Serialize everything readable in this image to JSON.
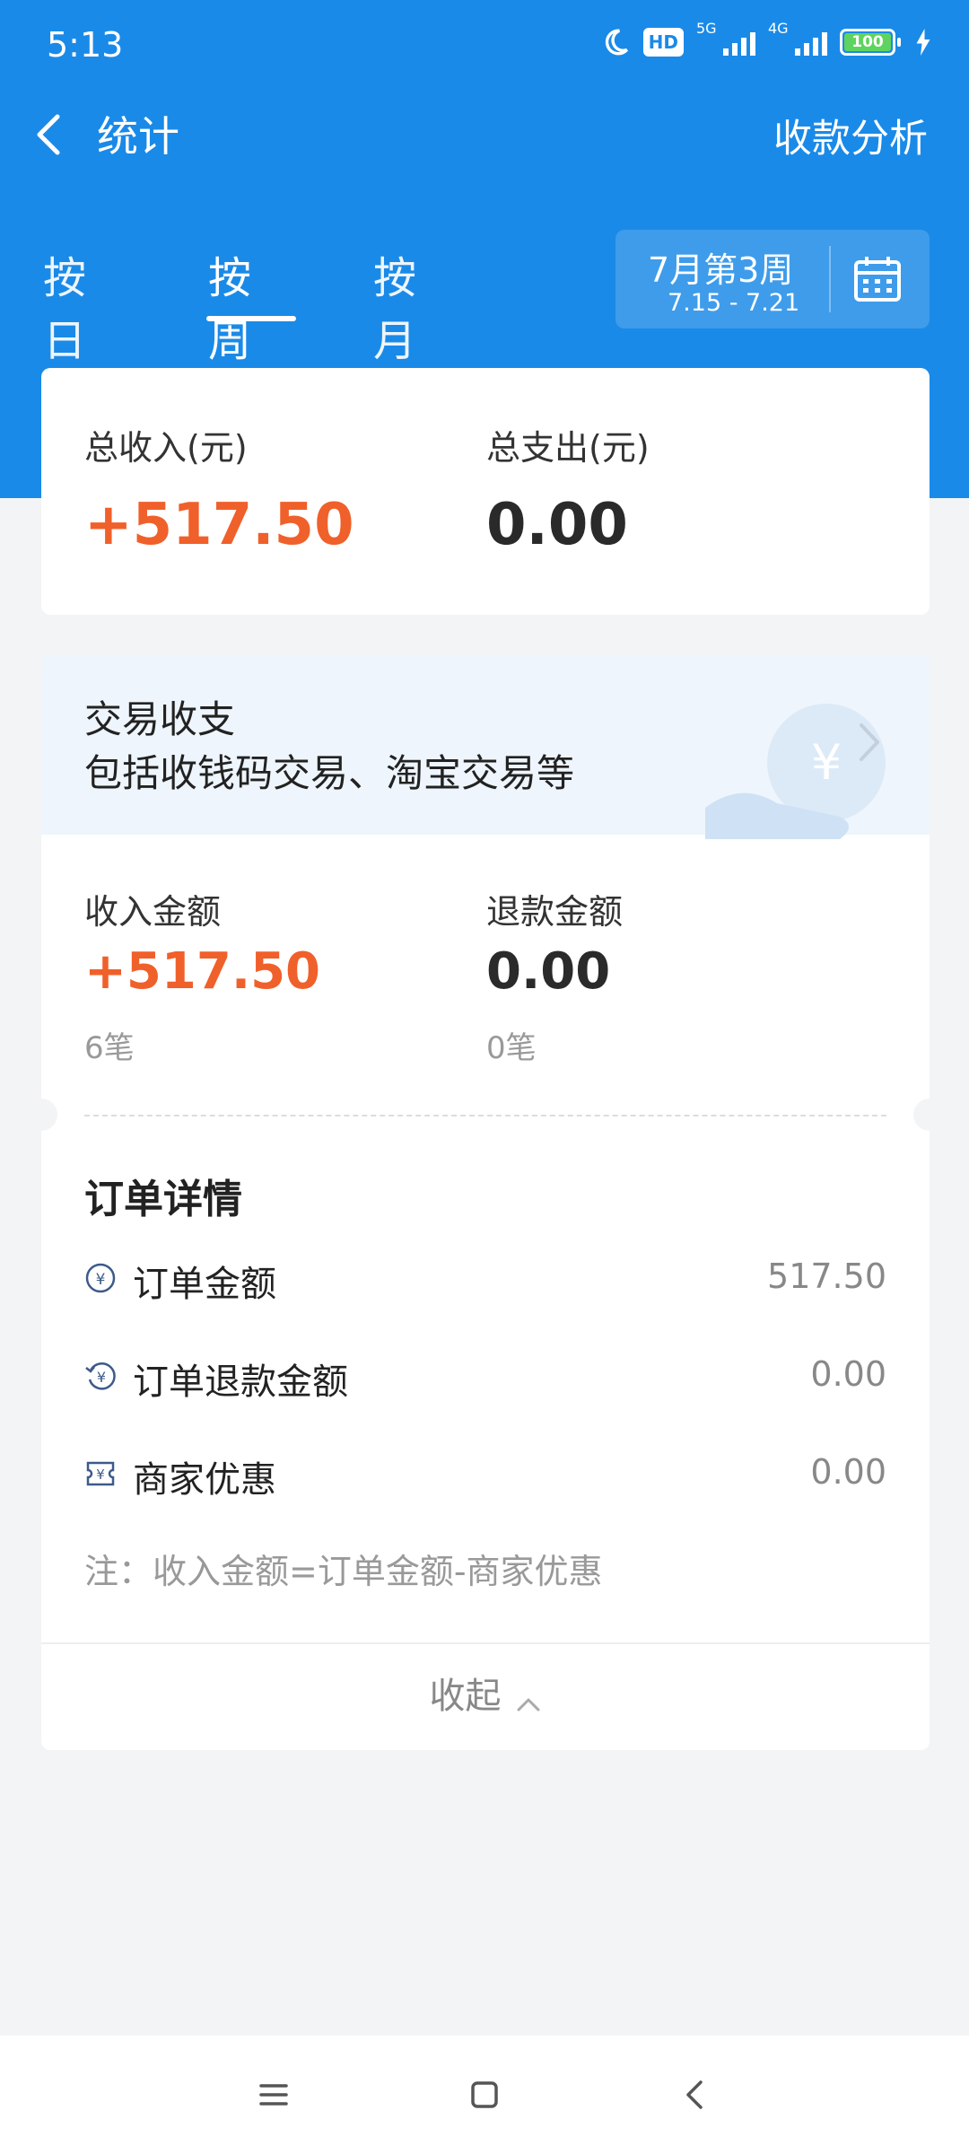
{
  "status_bar": {
    "time": "5:13",
    "icons": [
      "moon-icon",
      "hd-icon",
      "signal-5g-icon",
      "signal-4g-icon",
      "battery-icon",
      "charging-icon"
    ],
    "hd": "HD",
    "net1": "5G",
    "net2": "4G",
    "battery": "100"
  },
  "nav": {
    "title": "统计",
    "action": "收款分析"
  },
  "tabs": [
    {
      "label": "按日"
    },
    {
      "label": "按周"
    },
    {
      "label": "按月"
    }
  ],
  "week_picker": {
    "title": "7月第3周",
    "range": "7.15 - 7.21"
  },
  "summary": {
    "income_label": "总收入(元)",
    "income_value": "+517.50",
    "expense_label": "总支出(元)",
    "expense_value": "0.00"
  },
  "transactions": {
    "title": "交易收支",
    "subtitle": "包括收钱码交易、淘宝交易等",
    "income_label": "收入金额",
    "income_value": "+517.50",
    "income_count": "6笔",
    "refund_label": "退款金额",
    "refund_value": "0.00",
    "refund_count": "0笔"
  },
  "order_details": {
    "title": "订单详情",
    "rows": [
      {
        "label": "订单金额",
        "value": "517.50",
        "icon": "yuan-circle-icon"
      },
      {
        "label": "订单退款金额",
        "value": "0.00",
        "icon": "refund-icon"
      },
      {
        "label": "商家优惠",
        "value": "0.00",
        "icon": "coupon-icon"
      }
    ],
    "note": "注：收入金额=订单金额-商家优惠",
    "collapse": "收起"
  },
  "colors": {
    "header_blue": "#1a8ae8",
    "accent_orange": "#f0602a"
  }
}
